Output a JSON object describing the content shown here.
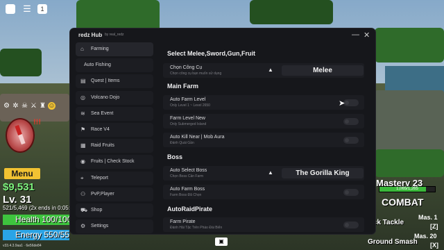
{
  "roblox": {
    "menu_icon": "hamburger-icon",
    "chat_badge": "1"
  },
  "hud": {
    "alert": "!!!",
    "menu_label": "Menu",
    "money": "$9,531",
    "level": "Lv. 31",
    "xp_text": "521/5,469 (2x ends in 0:05:",
    "health": "Health 100/100",
    "energy": "Energy 550/550",
    "version": "v33.4.3.9aa1 · 6e56de84",
    "mastery": "Mastery 23",
    "mastery_progress": "1,065/1,265",
    "mastery_fill": 0.84,
    "combat": "COMBAT",
    "skills": [
      {
        "name": "ick Tackle",
        "cost": "Mas. 1",
        "key": "[Z]"
      },
      {
        "name": "Ground Smash",
        "cost": "Mas. 20",
        "key": "[X]"
      }
    ]
  },
  "hub": {
    "title": "redz Hub",
    "subtitle": "by real_redz",
    "minimize": "—",
    "close": "✕",
    "sidebar": [
      {
        "label": "Farming",
        "icon": "home-icon",
        "glyph": "⌂",
        "active": true
      },
      {
        "label": "Auto Fishing",
        "icon": "",
        "glyph": ""
      },
      {
        "label": "Quest | Items",
        "icon": "scroll-icon",
        "glyph": "▤"
      },
      {
        "label": "Volcano Dojo",
        "icon": "globe-icon",
        "glyph": "◎"
      },
      {
        "label": "Sea Event",
        "icon": "wave-icon",
        "glyph": "≋"
      },
      {
        "label": "Race V4",
        "icon": "flag-icon",
        "glyph": "⚑"
      },
      {
        "label": "Raid Fruits",
        "icon": "grid-icon",
        "glyph": "▦"
      },
      {
        "label": "Fruits | Check Stock",
        "icon": "apple-icon",
        "glyph": "◉"
      },
      {
        "label": "Teleport",
        "icon": "pin-icon",
        "glyph": "⌖"
      },
      {
        "label": "PvP,Player",
        "icon": "users-icon",
        "glyph": "⚇"
      },
      {
        "label": "Shop",
        "icon": "cart-icon",
        "glyph": "⛟"
      },
      {
        "label": "Settings",
        "icon": "gear-icon",
        "glyph": "⚙"
      }
    ],
    "content": {
      "weapon_section": "Select Melee,Sword,Gun,Fruit",
      "weapon_row": {
        "label": "Chọn Công Cụ",
        "desc": "Chọn công cụ bạn muốn sử dụng",
        "value": "Melee"
      },
      "main_farm_section": "Main Farm",
      "main_farm_rows": [
        {
          "label": "Auto Farm Level",
          "desc": "Only Level 1 ~ Level 2650"
        },
        {
          "label": "Farm Level New",
          "desc": "Only Submerged Island"
        },
        {
          "label": "Auto Kill Near | Mob Aura",
          "desc": "Đánh Quái Gần"
        }
      ],
      "boss_section": "Boss",
      "boss_select_row": {
        "label": "Auto Select Boss",
        "desc": "Chọn Boss Cần Farm",
        "value": "The Gorilla King"
      },
      "boss_farm_row": {
        "label": "Auto Farm Boss",
        "desc": "Farm Boss Đã Chọn"
      },
      "raid_section": "AutoRaidPirate",
      "raid_row": {
        "label": "Farm Pirate",
        "desc": "Đánh Hải Tặc Trên Pháo Đài Biển"
      }
    }
  }
}
